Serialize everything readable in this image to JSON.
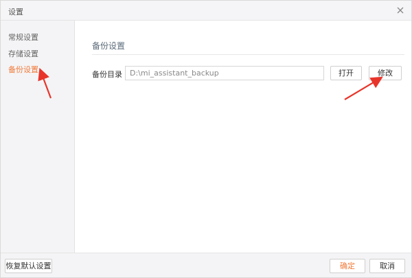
{
  "window": {
    "title": "设置"
  },
  "sidebar": {
    "items": [
      {
        "label": "常规设置"
      },
      {
        "label": "存储设置"
      },
      {
        "label": "备份设置"
      }
    ],
    "active_index": 2
  },
  "content": {
    "section_title": "备份设置",
    "backup_dir": {
      "label": "备份目录",
      "value": "D:\\mi_assistant_backup"
    },
    "open_button": "打开",
    "modify_button": "修改"
  },
  "footer": {
    "restore_defaults": "恢复默认设置",
    "confirm": "确定",
    "cancel": "取消"
  },
  "colors": {
    "accent": "#f07a3a",
    "annotation_arrow": "#e8352b"
  }
}
